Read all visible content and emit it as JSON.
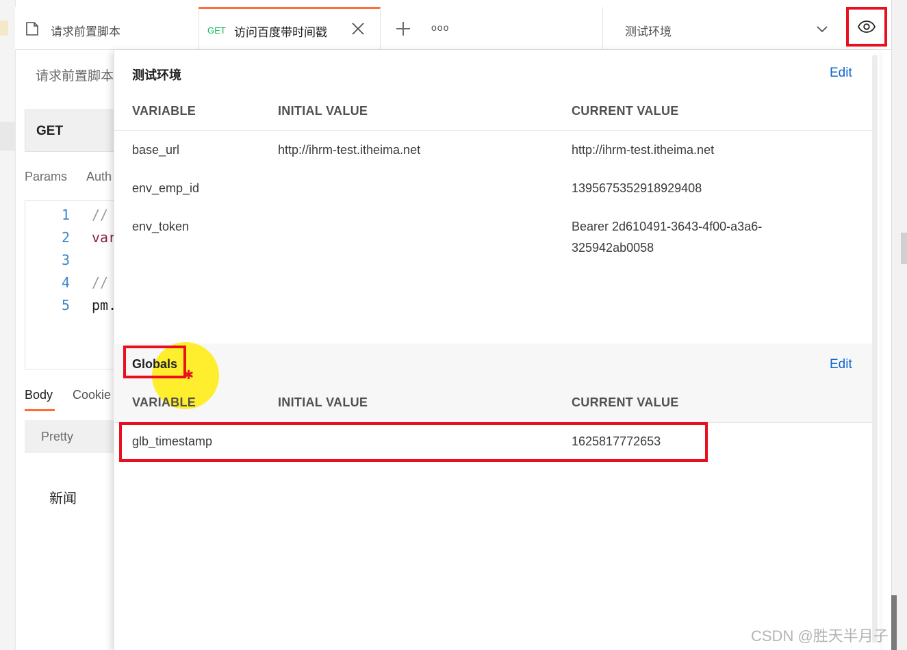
{
  "tabs": {
    "script_tab": {
      "label": "请求前置脚本"
    },
    "active_tab": {
      "method": "GET",
      "label": "访问百度带时间戳"
    },
    "more_label": "ooo"
  },
  "environment": {
    "selected": "测试环境"
  },
  "request": {
    "title": "请求前置脚本",
    "method": "GET",
    "tabs": [
      "Params",
      "Auth"
    ],
    "code_lines": [
      {
        "num": "1",
        "text": "//"
      },
      {
        "num": "2",
        "text": "var"
      },
      {
        "num": "3",
        "text": ""
      },
      {
        "num": "4",
        "text": "//"
      },
      {
        "num": "5",
        "text": "pm."
      }
    ],
    "response_tabs": [
      "Body",
      "Cookie"
    ],
    "pretty_label": "Pretty",
    "response_text": "新闻"
  },
  "env_popover": {
    "title": "测试环境",
    "edit_label": "Edit",
    "headers": [
      "VARIABLE",
      "INITIAL VALUE",
      "CURRENT VALUE"
    ],
    "rows": [
      {
        "variable": "base_url",
        "initial": "http://ihrm-test.itheima.net",
        "current": "http://ihrm-test.itheima.net"
      },
      {
        "variable": "env_emp_id",
        "initial": "",
        "current": "1395675352918929408"
      },
      {
        "variable": "env_token",
        "initial": "",
        "current": "Bearer 2d610491-3643-4f00-a3a6-325942ab0058"
      }
    ]
  },
  "globals_popover": {
    "title": "Globals",
    "edit_label": "Edit",
    "headers": [
      "VARIABLE",
      "INITIAL VALUE",
      "CURRENT VALUE"
    ],
    "rows": [
      {
        "variable": "glb_timestamp",
        "initial": "",
        "current": "1625817772653"
      }
    ]
  },
  "watermark": "CSDN @胜天半月子"
}
